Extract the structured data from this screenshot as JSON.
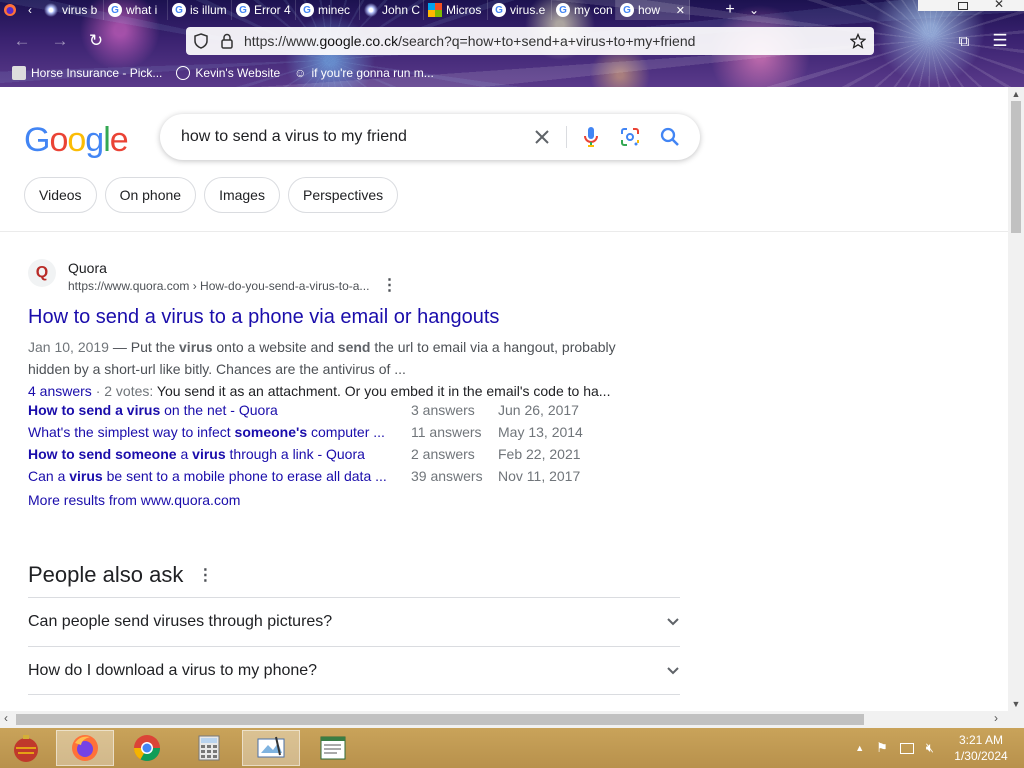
{
  "browser": {
    "tabs": [
      {
        "label": "virus b",
        "icon": "firework-favicon-icon"
      },
      {
        "label": "what i",
        "icon": "google-favicon-icon"
      },
      {
        "label": "is illum",
        "icon": "google-favicon-icon"
      },
      {
        "label": "Error 4",
        "icon": "google-favicon-icon"
      },
      {
        "label": "minec",
        "icon": "google-favicon-icon"
      },
      {
        "label": "John C",
        "icon": "firework-favicon-icon"
      },
      {
        "label": "Micros",
        "icon": "microsoft-favicon-icon"
      },
      {
        "label": "virus.e",
        "icon": "google-favicon-icon"
      },
      {
        "label": "my con",
        "icon": "google-favicon-icon"
      },
      {
        "label": "how",
        "icon": "google-favicon-icon",
        "active": true
      }
    ],
    "new_tab": "+",
    "url_prefix": "https://www.",
    "url_domain": "google.co.ck",
    "url_path": "/search?q=how+to+send+a+virus+to+my+friend",
    "bookmarks": [
      {
        "label": "Horse Insurance - Pick..."
      },
      {
        "label": "Kevin's Website"
      },
      {
        "label": "if you're gonna run m..."
      }
    ]
  },
  "google": {
    "logo": [
      "G",
      "o",
      "o",
      "g",
      "l",
      "e"
    ],
    "query": "how to send a virus to my friend",
    "chips": [
      "Videos",
      "On phone",
      "Images",
      "Perspectives"
    ]
  },
  "result": {
    "site_name": "Quora",
    "favicon_letter": "Q",
    "cite": "https://www.quora.com › How-do-you-send-a-virus-to-a...",
    "title": "How to send a virus to a phone via email or hangouts",
    "date": "Jan 10, 2019",
    "snippet_parts": [
      {
        "t": " — Put the ",
        "b": false
      },
      {
        "t": "virus",
        "b": true
      },
      {
        "t": " onto a website and ",
        "b": false
      },
      {
        "t": "send",
        "b": true
      },
      {
        "t": " the url to email via a hangout, probably hidden by a short-url like bitly. Chances are the antivirus of ...",
        "b": false
      }
    ],
    "answers_link": "4 answers",
    "votes": " · 2 votes: ",
    "answer_text": "You send it as an attachment. Or you embed it in the email's code to ha...",
    "sitelinks": [
      {
        "parts": [
          {
            "t": "How to send a virus",
            "b": true
          },
          {
            "t": " on the net - Quora",
            "b": false
          }
        ],
        "answers": "3 answers",
        "date": "Jun 26, 2017"
      },
      {
        "parts": [
          {
            "t": "What's the simplest way to infect ",
            "b": false
          },
          {
            "t": "someone's",
            "b": true
          },
          {
            "t": " computer ...",
            "b": false
          }
        ],
        "answers": "11 answers",
        "date": "May 13, 2014"
      },
      {
        "parts": [
          {
            "t": "How to send someone",
            "b": true
          },
          {
            "t": " a ",
            "b": false
          },
          {
            "t": "virus",
            "b": true
          },
          {
            "t": " through a link - Quora",
            "b": false
          }
        ],
        "answers": "2 answers",
        "date": "Feb 22, 2021"
      },
      {
        "parts": [
          {
            "t": "Can a ",
            "b": false
          },
          {
            "t": "virus",
            "b": true
          },
          {
            "t": " be sent to a mobile phone to erase all data ...",
            "b": false
          }
        ],
        "answers": "39 answers",
        "date": "Nov 11, 2017"
      }
    ],
    "more_results": "More results from www.quora.com"
  },
  "people_also_ask": {
    "heading": "People also ask",
    "questions": [
      "Can people send viruses through pictures?",
      "How do I download a virus to my phone?"
    ]
  },
  "taskbar": {
    "time": "3:21 AM",
    "date": "1/30/2024"
  }
}
